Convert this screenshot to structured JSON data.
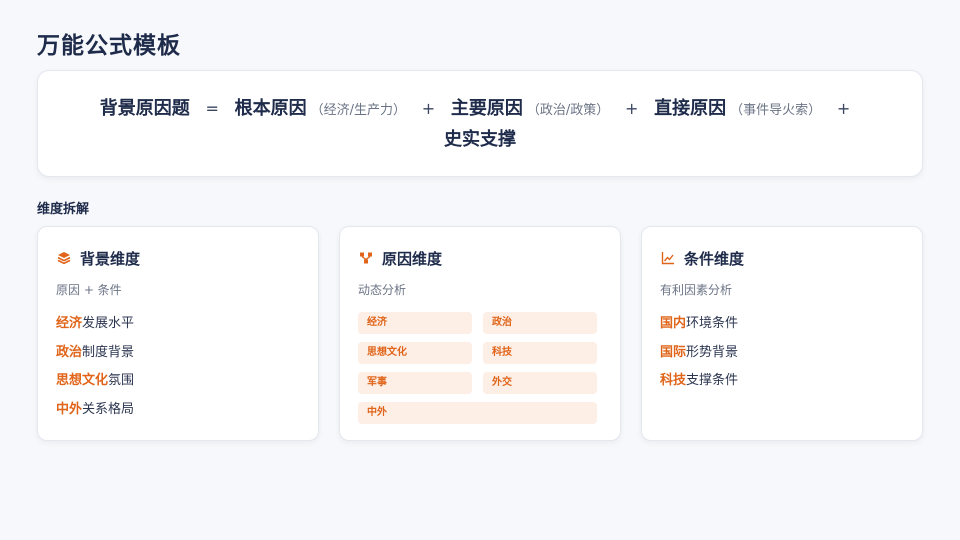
{
  "title": "万能公式模板",
  "formula": {
    "lhs": "背景原因题",
    "eq": "=",
    "terms": [
      {
        "term": "根本原因",
        "note": "（经济/生产力）"
      },
      {
        "term": "主要原因",
        "note": "（政治/政策）"
      },
      {
        "term": "直接原因",
        "note": "（事件导火索）"
      }
    ],
    "plus": "+",
    "last_term": "史实支撑"
  },
  "section_label": "维度拆解",
  "cards": [
    {
      "title": "背景维度",
      "subtitle": "原因 + 条件",
      "icon": "layers-icon",
      "items": [
        {
          "hl": "经济",
          "rest": "发展水平"
        },
        {
          "hl": "政治",
          "rest": "制度背景"
        },
        {
          "hl": "思想文化",
          "rest": "氛围"
        },
        {
          "hl": "中外",
          "rest": "关系格局"
        }
      ]
    },
    {
      "title": "原因维度",
      "subtitle": "动态分析",
      "icon": "nodes-icon",
      "tags": [
        "经济",
        "政治",
        "思想文化",
        "科技",
        "军事",
        "外交",
        "中外"
      ]
    },
    {
      "title": "条件维度",
      "subtitle": "有利因素分析",
      "icon": "line-chart-icon",
      "items": [
        {
          "hl": "国内",
          "rest": "环境条件"
        },
        {
          "hl": "国际",
          "rest": "形势背景"
        },
        {
          "hl": "科技",
          "rest": "支撑条件"
        }
      ]
    }
  ],
  "colors": {
    "accent": "#e0651a",
    "navy": "#1e2b4a",
    "tag_bg": "#fdeee6"
  }
}
